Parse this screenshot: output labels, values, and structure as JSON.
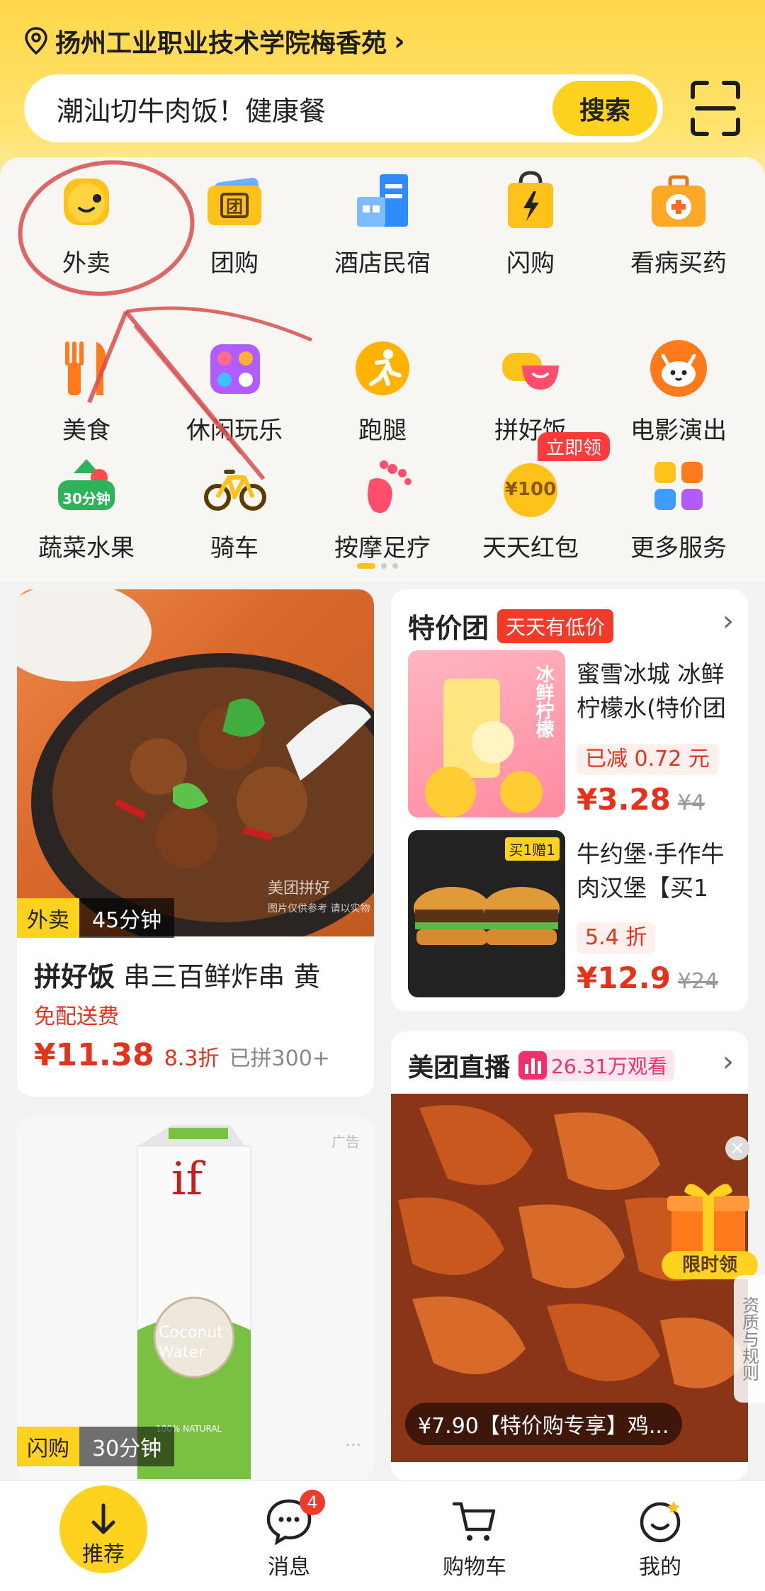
{
  "header": {
    "location": "扬州工业职业技术学院梅香苑",
    "search_placeholder": "潮汕切牛肉饭！健康餐",
    "search_button": "搜索"
  },
  "categories": [
    {
      "label": "外卖",
      "icon": "takeout-icon"
    },
    {
      "label": "团购",
      "icon": "group-buy-icon"
    },
    {
      "label": "酒店民宿",
      "icon": "hotel-icon"
    },
    {
      "label": "闪购",
      "icon": "flash-buy-icon"
    },
    {
      "label": "看病买药",
      "icon": "medicine-icon"
    },
    {
      "label": "美食",
      "icon": "food-icon"
    },
    {
      "label": "休闲玩乐",
      "icon": "leisure-icon"
    },
    {
      "label": "跑腿",
      "icon": "errand-icon"
    },
    {
      "label": "拼好饭",
      "icon": "group-meal-icon"
    },
    {
      "label": "电影演出",
      "icon": "movie-icon"
    },
    {
      "label": "蔬菜水果",
      "icon": "vegetable-icon",
      "badge": "30分钟"
    },
    {
      "label": "骑车",
      "icon": "bike-icon"
    },
    {
      "label": "按摩足疗",
      "icon": "massage-icon"
    },
    {
      "label": "天天红包",
      "icon": "red-packet-icon",
      "badge": "立即领",
      "coin": "¥100"
    },
    {
      "label": "更多服务",
      "icon": "more-services-icon"
    }
  ],
  "feed_left_1": {
    "tag": "外卖",
    "time": "45分钟",
    "watermark": "美团拼好",
    "watermark_note": "图片仅供参考 请以实物",
    "title_prefix": "拼好饭",
    "title": "串三百鲜炸串 黄",
    "delivery": "免配送费",
    "price": "¥11.38",
    "discount": "8.3折",
    "sold": "已拼300+"
  },
  "feed_right_special": {
    "title": "特价团",
    "badge": "天天有低价",
    "items": [
      {
        "name": "蜜雪冰城 冰鲜柠檬水(特价团",
        "tag": "已减 0.72 元",
        "price": "¥3.28",
        "old": "¥4",
        "img_text": "冰鲜柠檬"
      },
      {
        "name": "牛约堡·手作牛肉汉堡【买1",
        "tag": "5.4 折",
        "price": "¥12.9",
        "old": "¥24",
        "img_text": "买1赠1"
      }
    ]
  },
  "feed_right_live": {
    "title": "美团直播",
    "viewers": "26.31万观看",
    "caption": "¥7.90【特价购专享】鸡...",
    "gift_label": "限时领",
    "side_label": "资质与规则"
  },
  "feed_left_2": {
    "tag": "闪购",
    "time": "30分钟",
    "ad": "广告",
    "product_brand": "if",
    "product_name": "Coconut Water",
    "product_sub": "100% NATURAL"
  },
  "bottom_nav": [
    {
      "label": "推荐",
      "icon": "recommend-icon",
      "active": true
    },
    {
      "label": "消息",
      "icon": "message-icon",
      "badge": "4"
    },
    {
      "label": "购物车",
      "icon": "cart-icon"
    },
    {
      "label": "我的",
      "icon": "profile-icon"
    }
  ],
  "colors": {
    "brand_yellow": "#ffd21f",
    "price_red": "#e4321b",
    "annotation_red": "#d84c4c"
  }
}
